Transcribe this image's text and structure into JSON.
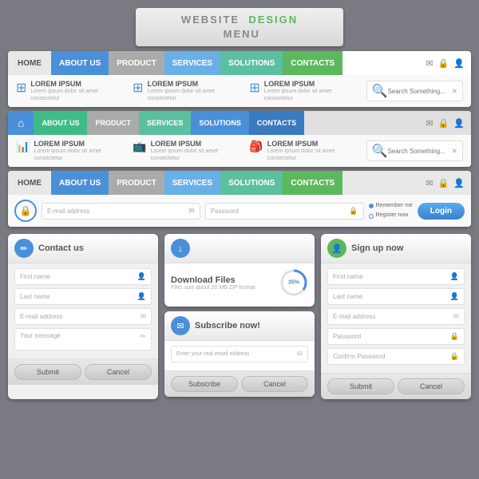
{
  "title": {
    "part1": "WEBSITE",
    "part2": "DESIGN",
    "part3": "MENU"
  },
  "nav1": {
    "home": "HOME",
    "about": "ABOUT US",
    "product": "PRODUCT",
    "services": "SERVICES",
    "solutions": "SOLUTIONS",
    "contacts": "CONTACTS",
    "search_placeholder": "Search Something..."
  },
  "nav2": {
    "about": "ABOUT US",
    "product": "PRODUCT",
    "services": "SERVICES",
    "solutions": "SOLUTIONS",
    "contacts": "CONTACTS",
    "search_placeholder": "Search Something..."
  },
  "nav3": {
    "home": "HOME",
    "about": "ABOUT US",
    "product": "PRODUCT",
    "services": "SERVICES",
    "solutions": "SOLUTIONS",
    "contacts": "CONTACTS"
  },
  "login": {
    "email_placeholder": "E-mail address",
    "password_placeholder": "Password",
    "remember": "Remember me",
    "register": "Register now",
    "button": "Login"
  },
  "lorem": "LOREM IPSUM",
  "lorem_sub": "Lorem ipsum dolor sit amet consectetur",
  "contact": {
    "title": "Contact us",
    "first_name": "First name",
    "last_name": "Last name",
    "email": "E-mail address",
    "message": "Your message",
    "submit": "Submit",
    "cancel": "Cancel"
  },
  "download": {
    "title": "Download Files",
    "subtitle": "Files size about 20 MB ZIP format",
    "progress": "35%",
    "subscribe_title": "Subscribe now!",
    "subscribe_placeholder": "Enter your real email address",
    "subscribe_btn": "Subscribe",
    "cancel_btn": "Cancel"
  },
  "signup": {
    "title": "Sign up now",
    "first_name": "First name",
    "last_name": "Last name",
    "email": "E-mail address",
    "password": "Password",
    "confirm_password": "Confirm Password",
    "submit": "Submit",
    "cancel": "Cancel"
  }
}
